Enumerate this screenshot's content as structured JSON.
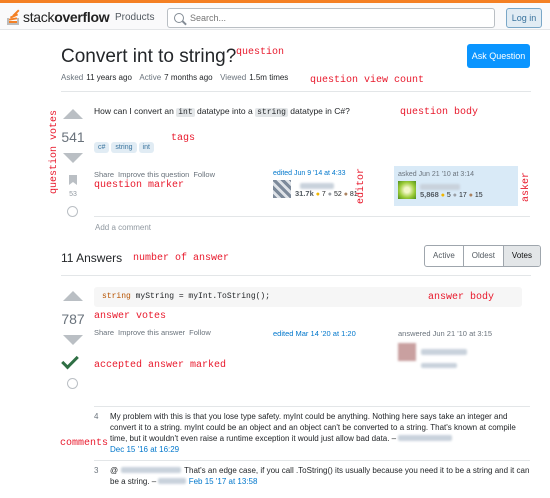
{
  "header": {
    "logo_light": "stack",
    "logo_bold": "overflow",
    "nav_products": "Products",
    "search_placeholder": "Search...",
    "login_label": "Log in"
  },
  "question": {
    "title": "Convert int to string?",
    "ask_button": "Ask Question",
    "meta": {
      "asked_label": "Asked",
      "asked_value": "11 years ago",
      "active_label": "Active",
      "active_value": "7 months ago",
      "viewed_label": "Viewed",
      "viewed_value": "1.5m times"
    },
    "votes": "541",
    "bookmarks": "53",
    "body_pre": "How can I convert an ",
    "body_code1": "int",
    "body_mid": " datatype into a ",
    "body_code2": "string",
    "body_post": " datatype in C#?",
    "tags": [
      "c#",
      "string",
      "int"
    ],
    "actions": [
      "Share",
      "Improve this question",
      "Follow"
    ],
    "editor": {
      "label": "edited Jun 9 '14 at 4:33",
      "rep": "31.7k",
      "gold": "7",
      "silver": "52",
      "bronze": "81"
    },
    "asker": {
      "label": "asked Jun 21 '10 at 3:14",
      "rep": "5,868",
      "gold": "5",
      "silver": "17",
      "bronze": "15"
    },
    "add_comment": "Add a comment"
  },
  "answers": {
    "count_label": "11 Answers",
    "sort_tabs": [
      "Active",
      "Oldest",
      "Votes"
    ]
  },
  "answer": {
    "votes": "787",
    "code_type": "string",
    "code_rest": " myString = myInt.ToString();",
    "actions": [
      "Share",
      "Improve this answer",
      "Follow"
    ],
    "edited": "edited Mar 14 '20 at 1:20",
    "answered": "answered Jun 21 '10 at 3:15"
  },
  "comments": [
    {
      "score": "4",
      "text": "My problem with this is that you lose type safety. myInt could be anything. Nothing here says take an integer and convert it to a string. myInt could be an object and an object can't be converted to a string. That's known at compile time, but it wouldn't even raise a runtime exception it would just allow bad data. –",
      "date": "Dec 15 '16 at 16:29"
    },
    {
      "score": "3",
      "prefix": "@",
      "text": "That's an edge case, if you call .ToString() its usually because you need it to be a string and it can be a string. –",
      "date": "Feb 15 '17 at 13:58"
    }
  ],
  "annotations": {
    "question": "question",
    "view_count": "question view count",
    "question_body": "question body",
    "question_votes": "question votes",
    "tags": "tags",
    "question_marker": "question marker",
    "editor": "editor",
    "asker": "asker",
    "number_of_answer": "number of answer",
    "answer_body": "answer body",
    "answer_votes": "answer votes",
    "accepted": "accepted answer marked",
    "comments": "comments"
  },
  "colors": {
    "accent": "#f48024",
    "primary_button": "#0a95ff",
    "annotation_red": "#e8192c",
    "accepted_green": "#2f6f44",
    "asker_card_bg": "#d9eaf7"
  }
}
